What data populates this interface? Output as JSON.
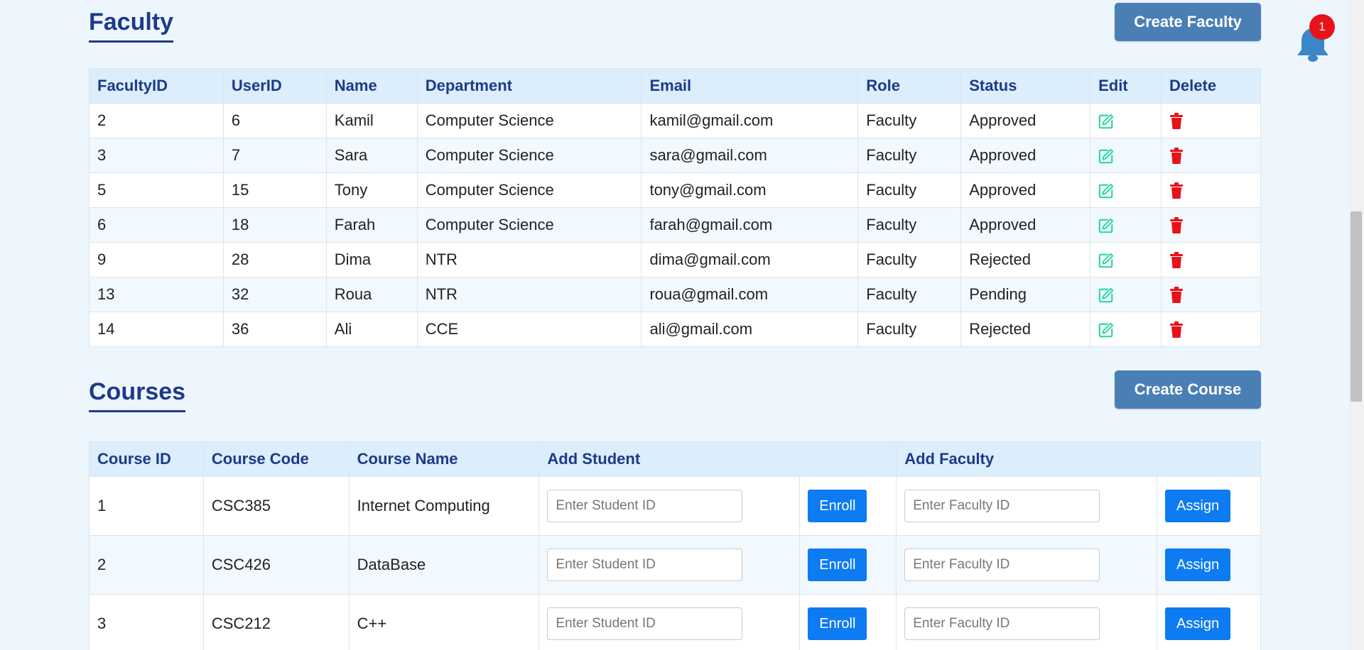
{
  "notifications": {
    "count": "1"
  },
  "faculty": {
    "title": "Faculty",
    "create_label": "Create Faculty",
    "columns": [
      "FacultyID",
      "UserID",
      "Name",
      "Department",
      "Email",
      "Role",
      "Status",
      "Edit",
      "Delete"
    ],
    "rows": [
      [
        "2",
        "6",
        "Kamil",
        "Computer Science",
        "kamil@gmail.com",
        "Faculty",
        "Approved"
      ],
      [
        "3",
        "7",
        "Sara",
        "Computer Science",
        "sara@gmail.com",
        "Faculty",
        "Approved"
      ],
      [
        "5",
        "15",
        "Tony",
        "Computer Science",
        "tony@gmail.com",
        "Faculty",
        "Approved"
      ],
      [
        "6",
        "18",
        "Farah",
        "Computer Science",
        "farah@gmail.com",
        "Faculty",
        "Approved"
      ],
      [
        "9",
        "28",
        "Dima",
        "NTR",
        "dima@gmail.com",
        "Faculty",
        "Rejected"
      ],
      [
        "13",
        "32",
        "Roua",
        "NTR",
        "roua@gmail.com",
        "Faculty",
        "Pending"
      ],
      [
        "14",
        "36",
        "Ali",
        "CCE",
        "ali@gmail.com",
        "Faculty",
        "Rejected"
      ]
    ]
  },
  "courses": {
    "title": "Courses",
    "create_label": "Create Course",
    "columns": [
      "Course ID",
      "Course Code",
      "Course Name",
      "Add Student",
      "Add Faculty"
    ],
    "student_placeholder": "Enter Student ID",
    "faculty_placeholder": "Enter Faculty ID",
    "enroll_label": "Enroll",
    "assign_label": "Assign",
    "rows": [
      [
        "1",
        "CSC385",
        "Internet Computing"
      ],
      [
        "2",
        "CSC426",
        "DataBase"
      ],
      [
        "3",
        "CSC212",
        "C++"
      ]
    ]
  },
  "colors": {
    "background": "#eef6fd",
    "heading": "#1d3a8a",
    "header_row": "#dcedfb",
    "create_button": "#4a7fb5",
    "action_button": "#0d7bf2",
    "edit_icon": "#2fd7a7",
    "delete_icon": "#e8121a",
    "badge": "#e8121a",
    "bell": "#3d86c9"
  },
  "icons": {
    "edit": "edit-icon",
    "delete": "trash-icon",
    "notification": "bell-icon"
  }
}
